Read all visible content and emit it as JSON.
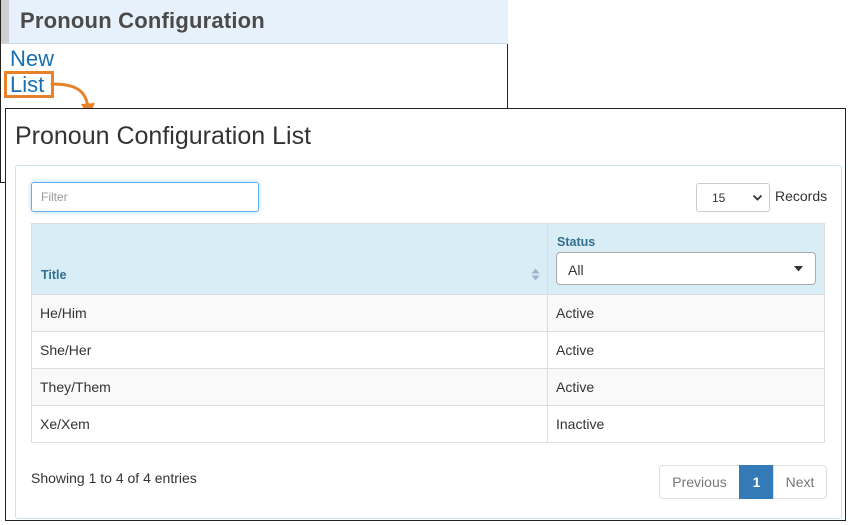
{
  "menu": {
    "title": "Pronoun Configuration",
    "links": [
      {
        "label": "New"
      },
      {
        "label": "List"
      }
    ]
  },
  "list_page": {
    "title": "Pronoun Configuration List",
    "filter": {
      "placeholder": "Filter",
      "value": ""
    },
    "page_size": {
      "selected": "15",
      "label": "Records"
    },
    "table": {
      "columns": {
        "title": "Title",
        "status": "Status"
      },
      "status_filter": {
        "selected": "All"
      },
      "rows": [
        {
          "title": "He/Him",
          "status": "Active"
        },
        {
          "title": "She/Her",
          "status": "Active"
        },
        {
          "title": "They/Them",
          "status": "Active"
        },
        {
          "title": "Xe/Xem",
          "status": "Inactive"
        }
      ]
    },
    "info": "Showing 1 to 4 of 4 entries",
    "pagination": {
      "previous": "Previous",
      "current": "1",
      "next": "Next"
    }
  },
  "icons": {
    "sort": "sort-icon",
    "chevron": "chevron-down-icon",
    "caret": "caret-down-icon",
    "arrow": "callout-arrow-icon"
  },
  "colors": {
    "accent": "#e8822a",
    "link": "#1a6fb0",
    "header_bg": "#d9edf7",
    "header_text": "#31708f",
    "primary": "#337ab7"
  }
}
